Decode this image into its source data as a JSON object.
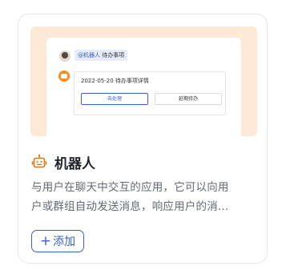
{
  "preview": {
    "mention": "@机器人",
    "todo_label": "待办事项",
    "message_title": "2022-05-20 待办事项详情",
    "handle_button": "去处理",
    "delay_button": "延期待办"
  },
  "card": {
    "title": "机器人",
    "icon": "robot-icon",
    "description_line1": "与用户在聊天中交互的应用，它可以向用",
    "description_line2": "户或群组自动发送消息，响应用户的消...",
    "add_button_icon": "+",
    "add_button_label": "添加"
  },
  "colors": {
    "accent": "#3c5fd6",
    "icon_orange": "#d97a1a",
    "preview_bg": "#fde9d6"
  }
}
